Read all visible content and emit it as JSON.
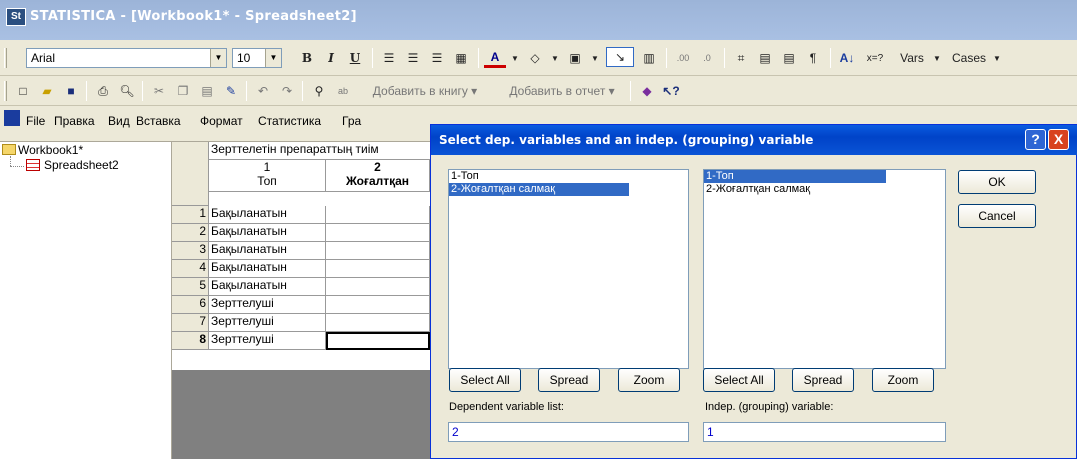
{
  "app": {
    "title": "STATISTICA - [Workbook1* - Spreadsheet2]",
    "icon": "statistica-icon"
  },
  "format_toolbar": {
    "font": "Arial",
    "size": "10",
    "bold": "B",
    "italic": "I",
    "underline": "U",
    "font_color": "A",
    "vars": "Vars",
    "cases": "Cases",
    "sort": "A↓",
    "xeq": "x=?"
  },
  "std_toolbar": {
    "add_workbook": "Добавить в книгу",
    "add_report": "Добавить в отчет"
  },
  "menu": [
    "File",
    "Правка",
    "Вид",
    "Вставка",
    "Формат",
    "Статистика",
    "Гра"
  ],
  "tree": {
    "root": "Workbook1*",
    "child": "Spreadsheet2"
  },
  "sheet": {
    "title": "Зерттелетін препараттың тиім",
    "col1_num": "1",
    "col1_name": "Топ",
    "col2_num": "2",
    "col2_name": "Жоғалтқан",
    "rows": [
      {
        "n": "1",
        "v": "Бақыланатын"
      },
      {
        "n": "2",
        "v": "Бақыланатын"
      },
      {
        "n": "3",
        "v": "Бақыланатын"
      },
      {
        "n": "4",
        "v": "Бақыланатын"
      },
      {
        "n": "5",
        "v": "Бақыланатын"
      },
      {
        "n": "6",
        "v": "Зерттелуші"
      },
      {
        "n": "7",
        "v": "Зерттелуші"
      },
      {
        "n": "8",
        "v": "Зерттелуші"
      }
    ]
  },
  "dialog": {
    "title": "Select dep. variables and an indep. (grouping) variable",
    "left_list": [
      "1-Топ",
      "2-Жоғалтқан салмақ"
    ],
    "right_list": [
      "1-Топ",
      "2-Жоғалтқан салмақ"
    ],
    "ok": "OK",
    "cancel": "Cancel",
    "select_all": "Select All",
    "spread": "Spread",
    "zoom": "Zoom",
    "dep_label": "Dependent variable list:",
    "indep_label": "Indep. (grouping) variable:",
    "dep_value": "2",
    "indep_value": "1",
    "help": "?",
    "close": "X"
  }
}
